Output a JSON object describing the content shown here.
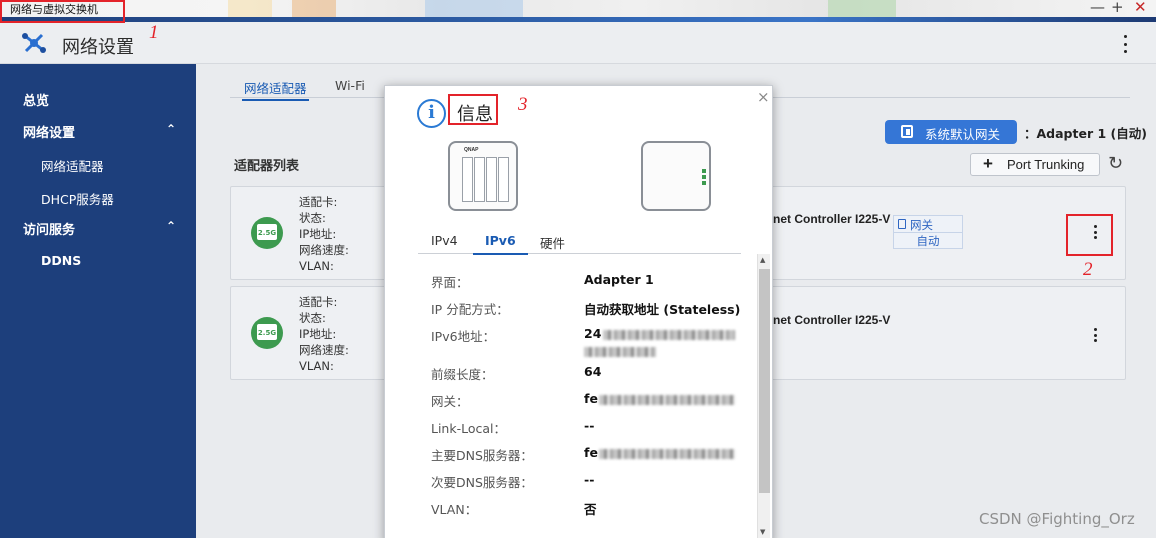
{
  "window": {
    "title": "网络与虚拟交换机",
    "controls": [
      "—",
      "+",
      "✕"
    ]
  },
  "app": {
    "title": "网络设置"
  },
  "sidebar": {
    "items": [
      {
        "label": "总览"
      },
      {
        "label": "网络设置",
        "expand": "⌃"
      },
      {
        "label": "网络适配器"
      },
      {
        "label": "DHCP服务器"
      },
      {
        "label": "访问服务",
        "expand": "⌃"
      },
      {
        "label": "DDNS"
      }
    ]
  },
  "main": {
    "tabs": [
      {
        "label": "网络适配器"
      },
      {
        "label": "Wi-Fi"
      }
    ],
    "gateway_button": "系统默认网关",
    "gateway_adapter": "：Adapter 1 (自动)",
    "list_title": "适配器列表",
    "port_trunking": "Port Trunking",
    "port_trunking_icon": "+",
    "refresh_icon": "↻",
    "cards": [
      {
        "badge": "2.5G",
        "labels": [
          "适配卡:",
          "状态:",
          "IP地址:",
          "网络速度:",
          "VLAN:"
        ],
        "controller": "net Controller I225-V",
        "gateway_tag": "网关",
        "gateway_mode": "自动"
      },
      {
        "badge": "2.5G",
        "labels": [
          "适配卡:",
          "状态:",
          "IP地址:",
          "网络速度:",
          "VLAN:"
        ],
        "controller": "net Controller I225-V"
      }
    ]
  },
  "dialog": {
    "title": "信息",
    "close": "×",
    "info_icon": "i",
    "device_brand": "QNAP",
    "tabs": [
      {
        "label": "IPv4"
      },
      {
        "label": "IPv6"
      },
      {
        "label": "硬件"
      }
    ],
    "rows": [
      {
        "key": "界面：",
        "value": "Adapter 1"
      },
      {
        "key": "IP 分配方式：",
        "value": "自动获取地址 (Stateless)"
      },
      {
        "key": "IPv6地址：",
        "value": "24"
      },
      {
        "key": "前缀长度：",
        "value": "64"
      },
      {
        "key": "网关：",
        "value": "fe"
      },
      {
        "key": "Link-Local：",
        "value": "--"
      },
      {
        "key": "主要DNS服务器：",
        "value": "fe"
      },
      {
        "key": "次要DNS服务器：",
        "value": "--"
      },
      {
        "key": "VLAN：",
        "value": "否"
      }
    ]
  },
  "annotations": [
    "1",
    "2",
    "3"
  ],
  "watermark": "CSDN @Fighting_Orz",
  "colors": {
    "sidebar": "#1d3f7c",
    "accent_blue": "#3576d6",
    "annotation_red": "#e3232a",
    "badge_green": "#3d9a4f"
  }
}
